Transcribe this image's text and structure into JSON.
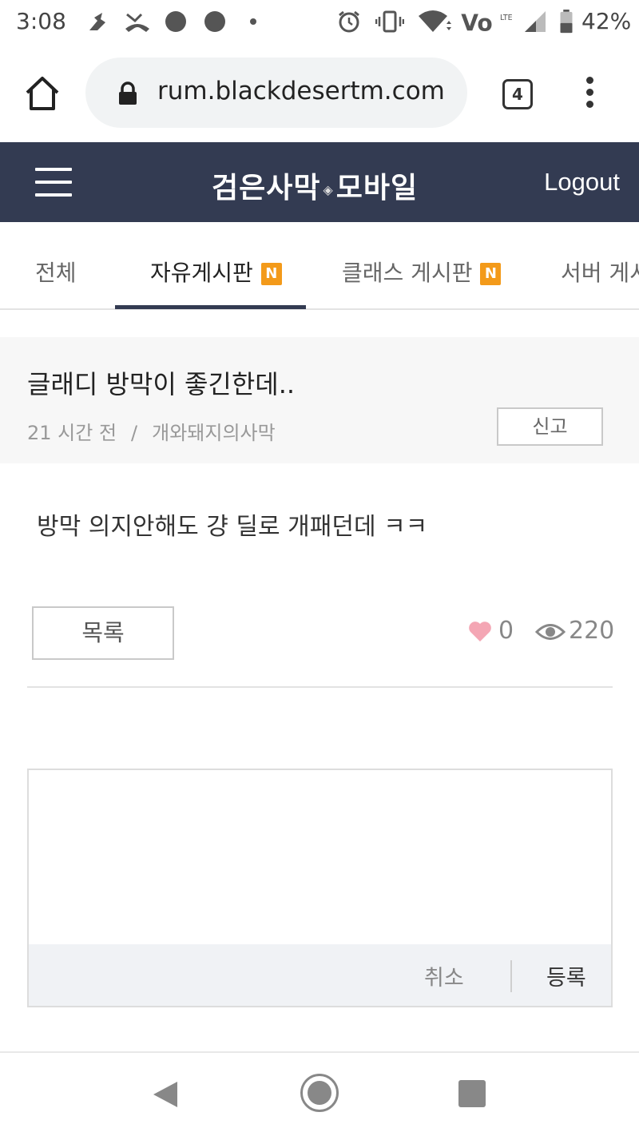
{
  "status_bar": {
    "time": "3:08",
    "battery": "42%",
    "icons": [
      "notification-icon",
      "missed-call-icon",
      "dot-icon",
      "dot-icon",
      "small-dot-icon",
      "alarm-icon",
      "vibrate-icon",
      "wifi-icon",
      "volte-icon",
      "signal-icon",
      "battery-icon"
    ]
  },
  "browser": {
    "url": "rum.blackdesertm.com",
    "tab_count": "4"
  },
  "header": {
    "logo_left": "검은사막",
    "logo_sep": "◈",
    "logo_right": "모바일",
    "logout": "Logout",
    "color": "#333b52"
  },
  "tabs": [
    {
      "label": "전체"
    },
    {
      "label": "자유게시판",
      "badge": "N"
    },
    {
      "label": "클래스 게시판",
      "badge": "N"
    },
    {
      "label": "서버 게시"
    }
  ],
  "post": {
    "title": "글래디 방막이 좋긴한데..",
    "time": "21 시간 전",
    "meta_sep": "/",
    "author": "개와돼지의사막",
    "report": "신고",
    "body": "방막 의지안해도 걍 딜로 개패던데 ㅋㅋ",
    "list_button": "목록",
    "likes": "0",
    "views": "220"
  },
  "comment": {
    "placeholder": "",
    "cancel": "취소",
    "submit": "등록"
  },
  "colors": {
    "badge": "#f39a1a",
    "heart": "#f4a6b4"
  }
}
